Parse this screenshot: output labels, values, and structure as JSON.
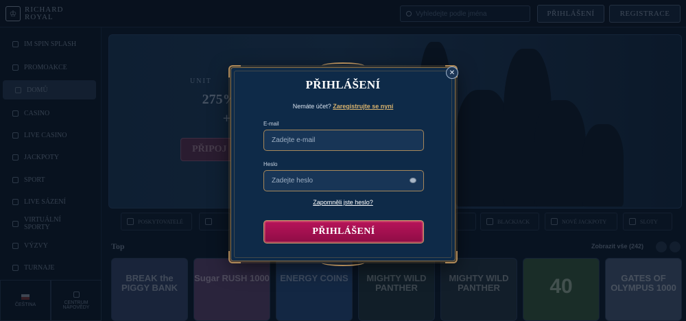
{
  "header": {
    "logo_text": "RICHARD\nROYAL",
    "search_placeholder": "Vyhledejte podle jména",
    "login_label": "PŘIHLÁŠENÍ",
    "register_label": "REGISTRACE"
  },
  "sidebar": {
    "items": [
      {
        "label": "IM SPIN SPLASH"
      },
      {
        "label": "PROMOAKCE"
      },
      {
        "label": "DOMŮ"
      },
      {
        "label": "CASINO"
      },
      {
        "label": "LIVE CASINO"
      },
      {
        "label": "JACKPOTY"
      },
      {
        "label": "SPORT"
      },
      {
        "label": "LIVE SÁZENÍ"
      },
      {
        "label": "VIRTUÁLNÍ SPORTY"
      },
      {
        "label": "VÝZVY"
      },
      {
        "label": "TURNAJE"
      }
    ],
    "language": "ČEŠTINA",
    "help_center": "CENTRUM NÁPOVĚDY"
  },
  "hero": {
    "small_text": "UNIT",
    "headline_1": "275% AŽ 1",
    "headline_2": "+ 22",
    "cta": "PŘIPOJ"
  },
  "categories": [
    {
      "label": "POSKYTOVATELÉ"
    },
    {
      "label": "BLACKJACK"
    },
    {
      "label": "NOVÉ JACKPOTY"
    },
    {
      "label": "SLOTY"
    }
  ],
  "games": {
    "section_title": "Top",
    "show_all": "Zobrazit vše (242)",
    "tiles": [
      {
        "title": "BREAK the PIGGY BANK"
      },
      {
        "title": "Sugar RUSH 1000"
      },
      {
        "title": "ENERGY COINS"
      },
      {
        "title": "MIGHTY WILD PANTHER"
      },
      {
        "title": "MIGHTY WILD PANTHER"
      },
      {
        "title": "40"
      },
      {
        "title": "GATES OF OLYMPUS 1000"
      }
    ]
  },
  "login_modal": {
    "title": "PŘIHLÁŠENÍ",
    "no_account_text": "Nemáte účet?",
    "register_link": "Zaregistrujte se nyní",
    "email_label": "E-mail",
    "email_placeholder": "Zadejte e-mail",
    "password_label": "Heslo",
    "password_placeholder": "Zadejte heslo",
    "forgot_link": "Zapomněli jste heslo?",
    "submit_label": "PŘIHLÁŠENÍ",
    "close_glyph": "✕"
  }
}
